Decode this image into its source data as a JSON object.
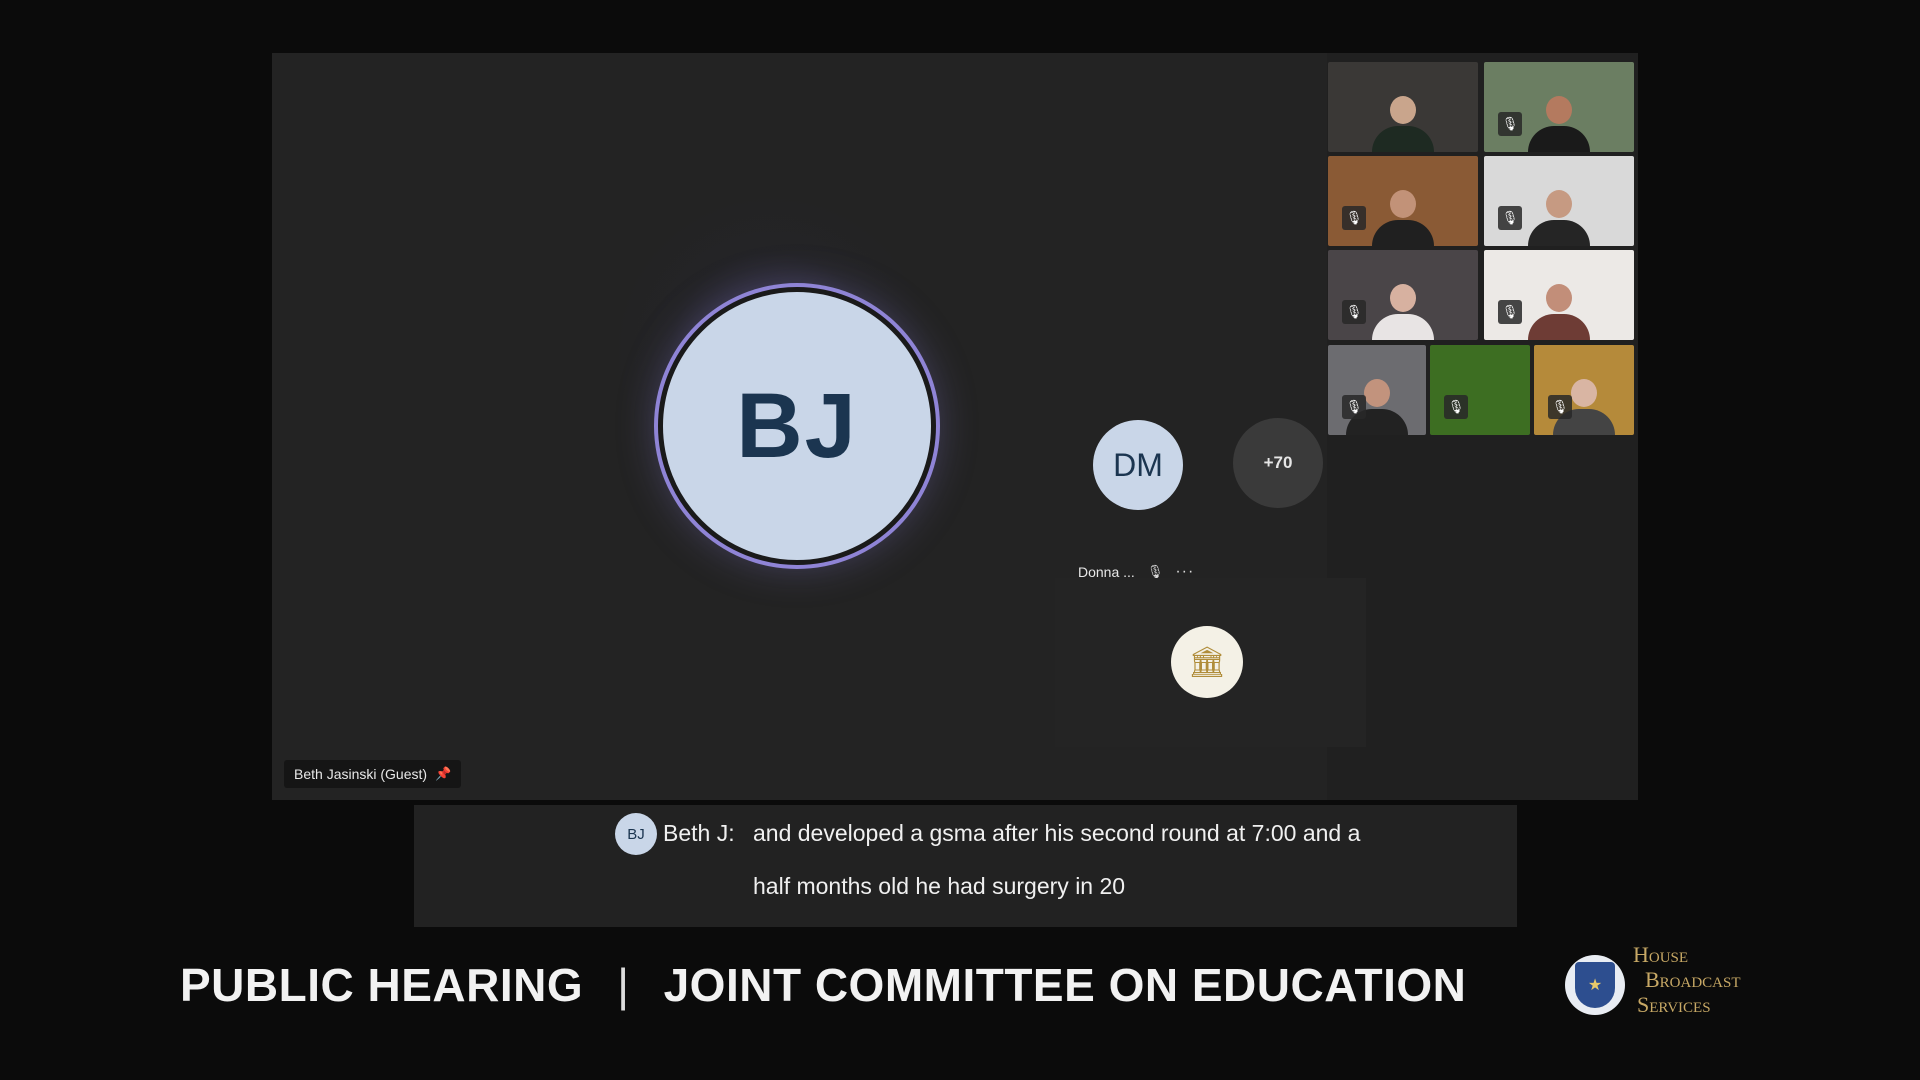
{
  "stage": {
    "avatar_initials": "BJ",
    "name_tag": "Beth Jasinski (Guest)"
  },
  "sidebar": {
    "tiles": [
      {
        "id": "p1",
        "muted": false,
        "bg": "#3a3836",
        "head": "#c9a58c",
        "torso": "#1e2a22"
      },
      {
        "id": "p2",
        "muted": true,
        "bg": "#6b7e62",
        "head": "#b47a5f",
        "torso": "#1a1a1a"
      },
      {
        "id": "p3",
        "muted": true,
        "bg": "#8a5a35",
        "head": "#c29278",
        "torso": "#202020"
      },
      {
        "id": "p4",
        "muted": true,
        "bg": "#d9d9d9",
        "head": "#c69a82",
        "torso": "#252525"
      },
      {
        "id": "p5",
        "muted": true,
        "bg": "#4a4548",
        "head": "#d7b1a0",
        "torso": "#e8e4e4"
      },
      {
        "id": "p6",
        "muted": true,
        "bg": "#ece9e6",
        "head": "#c28e79",
        "torso": "#6e3c35"
      },
      {
        "id": "p7",
        "muted": true,
        "bg": "#6c6c70",
        "head": "#c2937d",
        "torso": "#222"
      },
      {
        "id": "p8",
        "muted": true,
        "bg": "#3d6e22",
        "head": "",
        "torso": ""
      },
      {
        "id": "p9",
        "muted": true,
        "bg": "#b58a3a",
        "head": "#d9b5a3",
        "torso": "#444"
      }
    ],
    "dm_initials": "DM",
    "dm_name": "Donna ...",
    "more_label": "+70",
    "options_glyph": "···"
  },
  "captions": {
    "avatar_initials": "BJ",
    "speaker": "Beth J:",
    "line1": "and developed a gsma after his second round at 7:00 and a",
    "line2": "half months old he had surgery in 20"
  },
  "banner": {
    "left": "PUBLIC HEARING",
    "separator": "|",
    "right": "JOINT COMMITTEE ON EDUCATION"
  },
  "broadcaster": {
    "line1": "House",
    "line2": "Broadcast",
    "line3": "Services"
  },
  "colors": {
    "accent_ring": "#8f84d6",
    "avatar_bg": "#c9d6e8",
    "avatar_text": "#1b3550",
    "gold": "#c7a865"
  }
}
